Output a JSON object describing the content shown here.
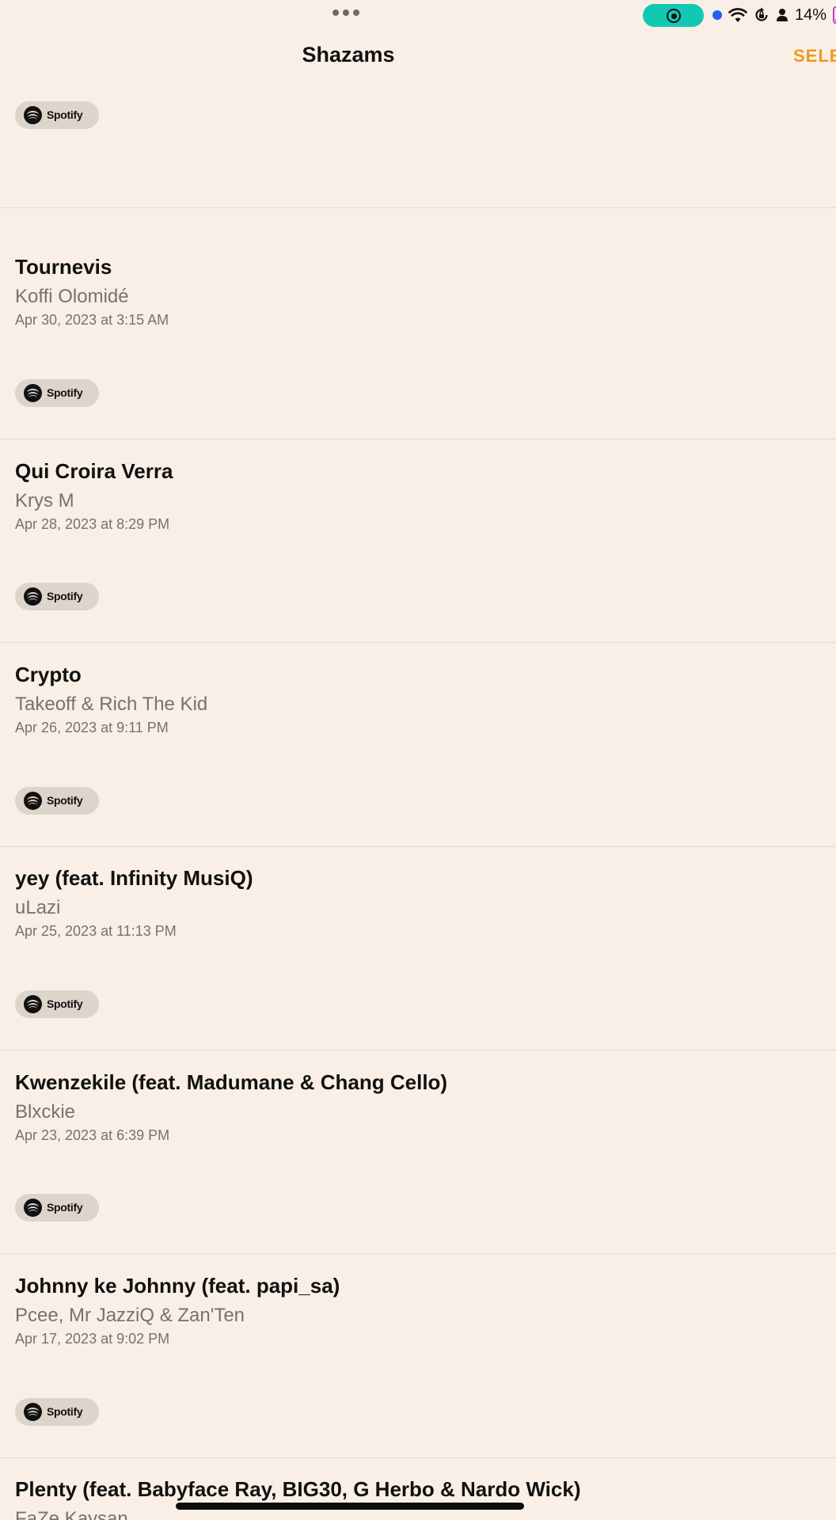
{
  "status_bar": {
    "battery": "14%",
    "colors": {
      "record_pill": "#13c8b3",
      "mic_dot": "#1d62f0",
      "battery": "#b93fbf"
    },
    "icons": [
      "multitask-dots-icon",
      "screen-record-icon",
      "mic-indicator-icon",
      "wifi-icon",
      "orientation-lock-icon",
      "person-icon",
      "battery-icon"
    ]
  },
  "header": {
    "title": "Shazams",
    "select_label": "SELE",
    "accent_color": "#ef9a1c"
  },
  "top_spotify": {
    "label": "Spotify"
  },
  "entries": [
    {
      "title": "Tournevis",
      "artist": "Koffi Olomidé",
      "date": "Apr 30, 2023 at 3:15 AM",
      "spotify_label": "Spotify"
    },
    {
      "title": "Qui Croira Verra",
      "artist": "Krys M",
      "date": "Apr 28, 2023 at 8:29 PM",
      "spotify_label": "Spotify"
    },
    {
      "title": "Crypto",
      "artist": "Takeoff & Rich The Kid",
      "date": "Apr 26, 2023 at 9:11 PM",
      "spotify_label": "Spotify"
    },
    {
      "title": "yey (feat. Infinity MusiQ)",
      "artist": "uLazi",
      "date": "Apr 25, 2023 at 11:13 PM",
      "spotify_label": "Spotify"
    },
    {
      "title": "Kwenzekile (feat. Madumane & Chang Cello)",
      "artist": "Blxckie",
      "date": "Apr 23, 2023 at 6:39 PM",
      "spotify_label": "Spotify"
    },
    {
      "title": "Johnny ke Johnny (feat. papi_sa)",
      "artist": "Pcee, Mr JazziQ & Zan'Ten",
      "date": "Apr 17, 2023 at 9:02 PM",
      "spotify_label": "Spotify"
    },
    {
      "title": "Plenty (feat. Babyface Ray, BIG30, G Herbo & Nardo Wick)",
      "artist": "FaZe Kaysan",
      "date": "",
      "spotify_label": ""
    }
  ]
}
